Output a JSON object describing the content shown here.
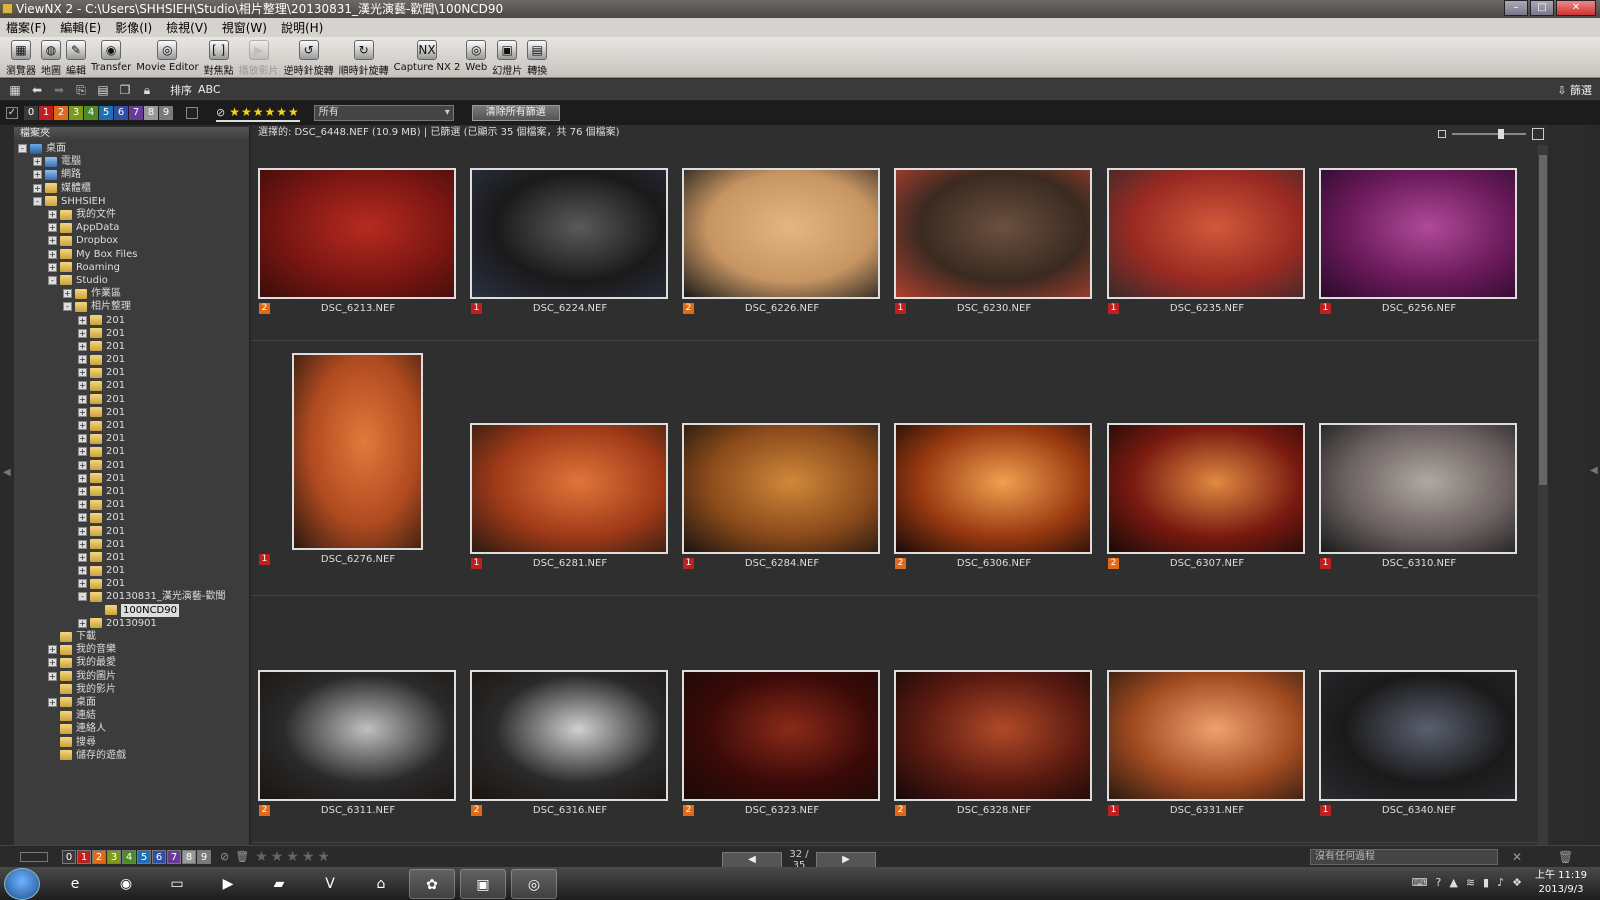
{
  "window": {
    "title": "ViewNX 2 - C:\\Users\\SHHSIEH\\Studio\\相片整理\\20130831_漢光演藝-歡聞\\100NCD90"
  },
  "menu": [
    "檔案(F)",
    "編輯(E)",
    "影像(I)",
    "檢視(V)",
    "視窗(W)",
    "說明(H)"
  ],
  "toolbar": [
    {
      "label": "瀏覽器",
      "icon": "browser-icon",
      "enabled": true
    },
    {
      "label": "地圖",
      "icon": "globe-icon",
      "enabled": true
    },
    {
      "label": "編輯",
      "icon": "edit-icon",
      "enabled": true
    },
    {
      "label": "Transfer",
      "icon": "camera-icon",
      "enabled": true
    },
    {
      "label": "Movie Editor",
      "icon": "film-icon",
      "enabled": true
    },
    {
      "label": "對焦點",
      "icon": "focus-bracket-icon",
      "enabled": true
    },
    {
      "label": "播放影片",
      "icon": "play-icon",
      "enabled": false
    },
    {
      "label": "逆時針旋轉",
      "icon": "rotate-ccw-icon",
      "enabled": true
    },
    {
      "label": "順時針旋轉",
      "icon": "rotate-cw-icon",
      "enabled": true
    },
    {
      "label": "Capture NX 2",
      "icon": "nx-icon",
      "enabled": true
    },
    {
      "label": "Web",
      "icon": "web-icon",
      "enabled": true
    },
    {
      "label": "幻燈片",
      "icon": "slideshow-icon",
      "enabled": true
    },
    {
      "label": "轉換",
      "icon": "convert-icon",
      "enabled": true
    }
  ],
  "navbar": {
    "sort_label": "排序",
    "sort_value": "ABC",
    "filter_label": "篩選"
  },
  "filterbar": {
    "labels": [
      "0",
      "1",
      "2",
      "3",
      "4",
      "5",
      "6",
      "7",
      "8",
      "9"
    ],
    "label_colors": [
      "#3a3a3a",
      "#c01f1f",
      "#e06a18",
      "#7a9a1a",
      "#4e8a28",
      "#1f6fb5",
      "#2f4fa5",
      "#6a3a9a",
      "#999999",
      "#7a7a7a"
    ],
    "stars": "★★★★★★",
    "select_value": "所有",
    "clear_button": "清除所有篩選"
  },
  "folder_panel": {
    "header": "檔案夾",
    "nodes": [
      {
        "label": "桌面",
        "depth": 0,
        "exp": "-",
        "type": "mon"
      },
      {
        "label": "電腦",
        "depth": 1,
        "exp": "+",
        "type": "blue"
      },
      {
        "label": "網路",
        "depth": 1,
        "exp": "+",
        "type": "blue"
      },
      {
        "label": "媒體櫃",
        "depth": 1,
        "exp": "+",
        "type": "folder"
      },
      {
        "label": "SHHSIEH",
        "depth": 1,
        "exp": "-",
        "type": "folder"
      },
      {
        "label": "我的文件",
        "depth": 2,
        "exp": "+",
        "type": "folder"
      },
      {
        "label": "AppData",
        "depth": 2,
        "exp": "+",
        "type": "folder"
      },
      {
        "label": "Dropbox",
        "depth": 2,
        "exp": "+",
        "type": "folder"
      },
      {
        "label": "My Box Files",
        "depth": 2,
        "exp": "+",
        "type": "folder"
      },
      {
        "label": "Roaming",
        "depth": 2,
        "exp": "+",
        "type": "folder"
      },
      {
        "label": "Studio",
        "depth": 2,
        "exp": "-",
        "type": "folder"
      },
      {
        "label": "作業區",
        "depth": 3,
        "exp": "+",
        "type": "folder"
      },
      {
        "label": "相片整理",
        "depth": 3,
        "exp": "-",
        "type": "folder"
      },
      {
        "label": "201",
        "depth": 4,
        "exp": "+",
        "type": "folder"
      },
      {
        "label": "201",
        "depth": 4,
        "exp": "+",
        "type": "folder"
      },
      {
        "label": "201",
        "depth": 4,
        "exp": "+",
        "type": "folder"
      },
      {
        "label": "201",
        "depth": 4,
        "exp": "+",
        "type": "folder"
      },
      {
        "label": "201",
        "depth": 4,
        "exp": "+",
        "type": "folder"
      },
      {
        "label": "201",
        "depth": 4,
        "exp": "+",
        "type": "folder"
      },
      {
        "label": "201",
        "depth": 4,
        "exp": "+",
        "type": "folder"
      },
      {
        "label": "201",
        "depth": 4,
        "exp": "+",
        "type": "folder"
      },
      {
        "label": "201",
        "depth": 4,
        "exp": "+",
        "type": "folder"
      },
      {
        "label": "201",
        "depth": 4,
        "exp": "+",
        "type": "folder"
      },
      {
        "label": "201",
        "depth": 4,
        "exp": "+",
        "type": "folder"
      },
      {
        "label": "201",
        "depth": 4,
        "exp": "+",
        "type": "folder"
      },
      {
        "label": "201",
        "depth": 4,
        "exp": "+",
        "type": "folder"
      },
      {
        "label": "201",
        "depth": 4,
        "exp": "+",
        "type": "folder"
      },
      {
        "label": "201",
        "depth": 4,
        "exp": "+",
        "type": "folder"
      },
      {
        "label": "201",
        "depth": 4,
        "exp": "+",
        "type": "folder"
      },
      {
        "label": "201",
        "depth": 4,
        "exp": "+",
        "type": "folder"
      },
      {
        "label": "201",
        "depth": 4,
        "exp": "+",
        "type": "folder"
      },
      {
        "label": "201",
        "depth": 4,
        "exp": "+",
        "type": "folder"
      },
      {
        "label": "201",
        "depth": 4,
        "exp": "+",
        "type": "folder"
      },
      {
        "label": "201",
        "depth": 4,
        "exp": "+",
        "type": "folder"
      },
      {
        "label": "20130831_漢光演藝-歡聞",
        "depth": 4,
        "exp": "-",
        "type": "folder"
      },
      {
        "label": "100NCD90",
        "depth": 5,
        "exp": "",
        "type": "folder",
        "selected": true
      },
      {
        "label": "20130901",
        "depth": 4,
        "exp": "+",
        "type": "folder"
      },
      {
        "label": "下載",
        "depth": 2,
        "exp": "",
        "type": "folder"
      },
      {
        "label": "我的音樂",
        "depth": 2,
        "exp": "+",
        "type": "folder"
      },
      {
        "label": "我的最愛",
        "depth": 2,
        "exp": "+",
        "type": "folder"
      },
      {
        "label": "我的圖片",
        "depth": 2,
        "exp": "+",
        "type": "folder"
      },
      {
        "label": "我的影片",
        "depth": 2,
        "exp": "",
        "type": "folder"
      },
      {
        "label": "桌面",
        "depth": 2,
        "exp": "+",
        "type": "folder"
      },
      {
        "label": "連結",
        "depth": 2,
        "exp": "",
        "type": "folder"
      },
      {
        "label": "連絡人",
        "depth": 2,
        "exp": "",
        "type": "folder"
      },
      {
        "label": "搜尋",
        "depth": 2,
        "exp": "",
        "type": "folder"
      },
      {
        "label": "儲存的遊戲",
        "depth": 2,
        "exp": "",
        "type": "folder"
      }
    ]
  },
  "status": {
    "text": "選擇的: DSC_6448.NEF (10.9 MB) | 已篩選 (已顯示 35 個檔案，共 76 個檔案)"
  },
  "thumbnails": [
    {
      "name": "DSC_6213.NEF",
      "label": "2",
      "orient": "h",
      "colors": [
        "#7a1612",
        "#b72b20",
        "#3a0d0a"
      ]
    },
    {
      "name": "DSC_6224.NEF",
      "label": "1",
      "orient": "h",
      "colors": [
        "#1a1a1a",
        "#5a5a5a",
        "#2a3040"
      ]
    },
    {
      "name": "DSC_6226.NEF",
      "label": "2",
      "orient": "h",
      "colors": [
        "#c79562",
        "#e3b680",
        "#1a1a1a"
      ]
    },
    {
      "name": "DSC_6230.NEF",
      "label": "1",
      "orient": "h",
      "colors": [
        "#3a2a20",
        "#6a5040",
        "#b04030"
      ]
    },
    {
      "name": "DSC_6235.NEF",
      "label": "1",
      "orient": "h",
      "colors": [
        "#9a2a22",
        "#d25a3a",
        "#3a2a2a"
      ]
    },
    {
      "name": "DSC_6256.NEF",
      "label": "1",
      "orient": "h",
      "colors": [
        "#6a1a5a",
        "#b04a9a",
        "#2a0a2a"
      ]
    },
    {
      "name": "DSC_6276.NEF",
      "label": "1",
      "orient": "v",
      "colors": [
        "#b04a20",
        "#e07a3a",
        "#2a1a10"
      ]
    },
    {
      "name": "DSC_6281.NEF",
      "label": "1",
      "orient": "h",
      "colors": [
        "#a03a18",
        "#e0763a",
        "#2a1a10"
      ]
    },
    {
      "name": "DSC_6284.NEF",
      "label": "1",
      "orient": "h",
      "colors": [
        "#8a4a1a",
        "#d0883a",
        "#1a1410"
      ]
    },
    {
      "name": "DSC_6306.NEF",
      "label": "2",
      "orient": "h",
      "colors": [
        "#9a3a10",
        "#f0a050",
        "#1a0a08"
      ]
    },
    {
      "name": "DSC_6307.NEF",
      "label": "2",
      "orient": "h",
      "colors": [
        "#7a1a10",
        "#e08a40",
        "#1a0a08"
      ]
    },
    {
      "name": "DSC_6310.NEF",
      "label": "1",
      "orient": "h",
      "colors": [
        "#6a6060",
        "#b0a8a0",
        "#1a1a1a"
      ]
    },
    {
      "name": "DSC_6311.NEF",
      "label": "2",
      "orient": "h",
      "colors": [
        "#2a2a2a",
        "#c0c0c0",
        "#1a1410"
      ]
    },
    {
      "name": "DSC_6316.NEF",
      "label": "2",
      "orient": "h",
      "colors": [
        "#2a2a2a",
        "#d0d0d0",
        "#1a1410"
      ]
    },
    {
      "name": "DSC_6323.NEF",
      "label": "2",
      "orient": "h",
      "colors": [
        "#3a0a08",
        "#8a2a18",
        "#1a0a08"
      ]
    },
    {
      "name": "DSC_6328.NEF",
      "label": "2",
      "orient": "h",
      "colors": [
        "#5a1a10",
        "#b04a28",
        "#140808"
      ]
    },
    {
      "name": "DSC_6331.NEF",
      "label": "1",
      "orient": "h",
      "colors": [
        "#a04a20",
        "#f0a070",
        "#2a1a10"
      ]
    },
    {
      "name": "DSC_6340.NEF",
      "label": "1",
      "orient": "h",
      "colors": [
        "#1a1a1a",
        "#5a6070",
        "#2a2a30"
      ]
    }
  ],
  "bottombar": {
    "labels": [
      "0",
      "1",
      "2",
      "3",
      "4",
      "5",
      "6",
      "7",
      "8",
      "9"
    ],
    "stars": "★★★★★",
    "prev": "◀",
    "next": "▶",
    "page": "32 / 35",
    "progress_text": "沒有任何過程"
  },
  "taskbar": {
    "apps": [
      "ie-icon",
      "chrome-icon",
      "explorer-icon",
      "media-player-icon",
      "notepad-icon",
      "vim-icon",
      "network-icon",
      "app-icon",
      "viewnx-icon",
      "camera-app-icon"
    ],
    "clock_time": "上午 11:19",
    "clock_date": "2013/9/3"
  }
}
